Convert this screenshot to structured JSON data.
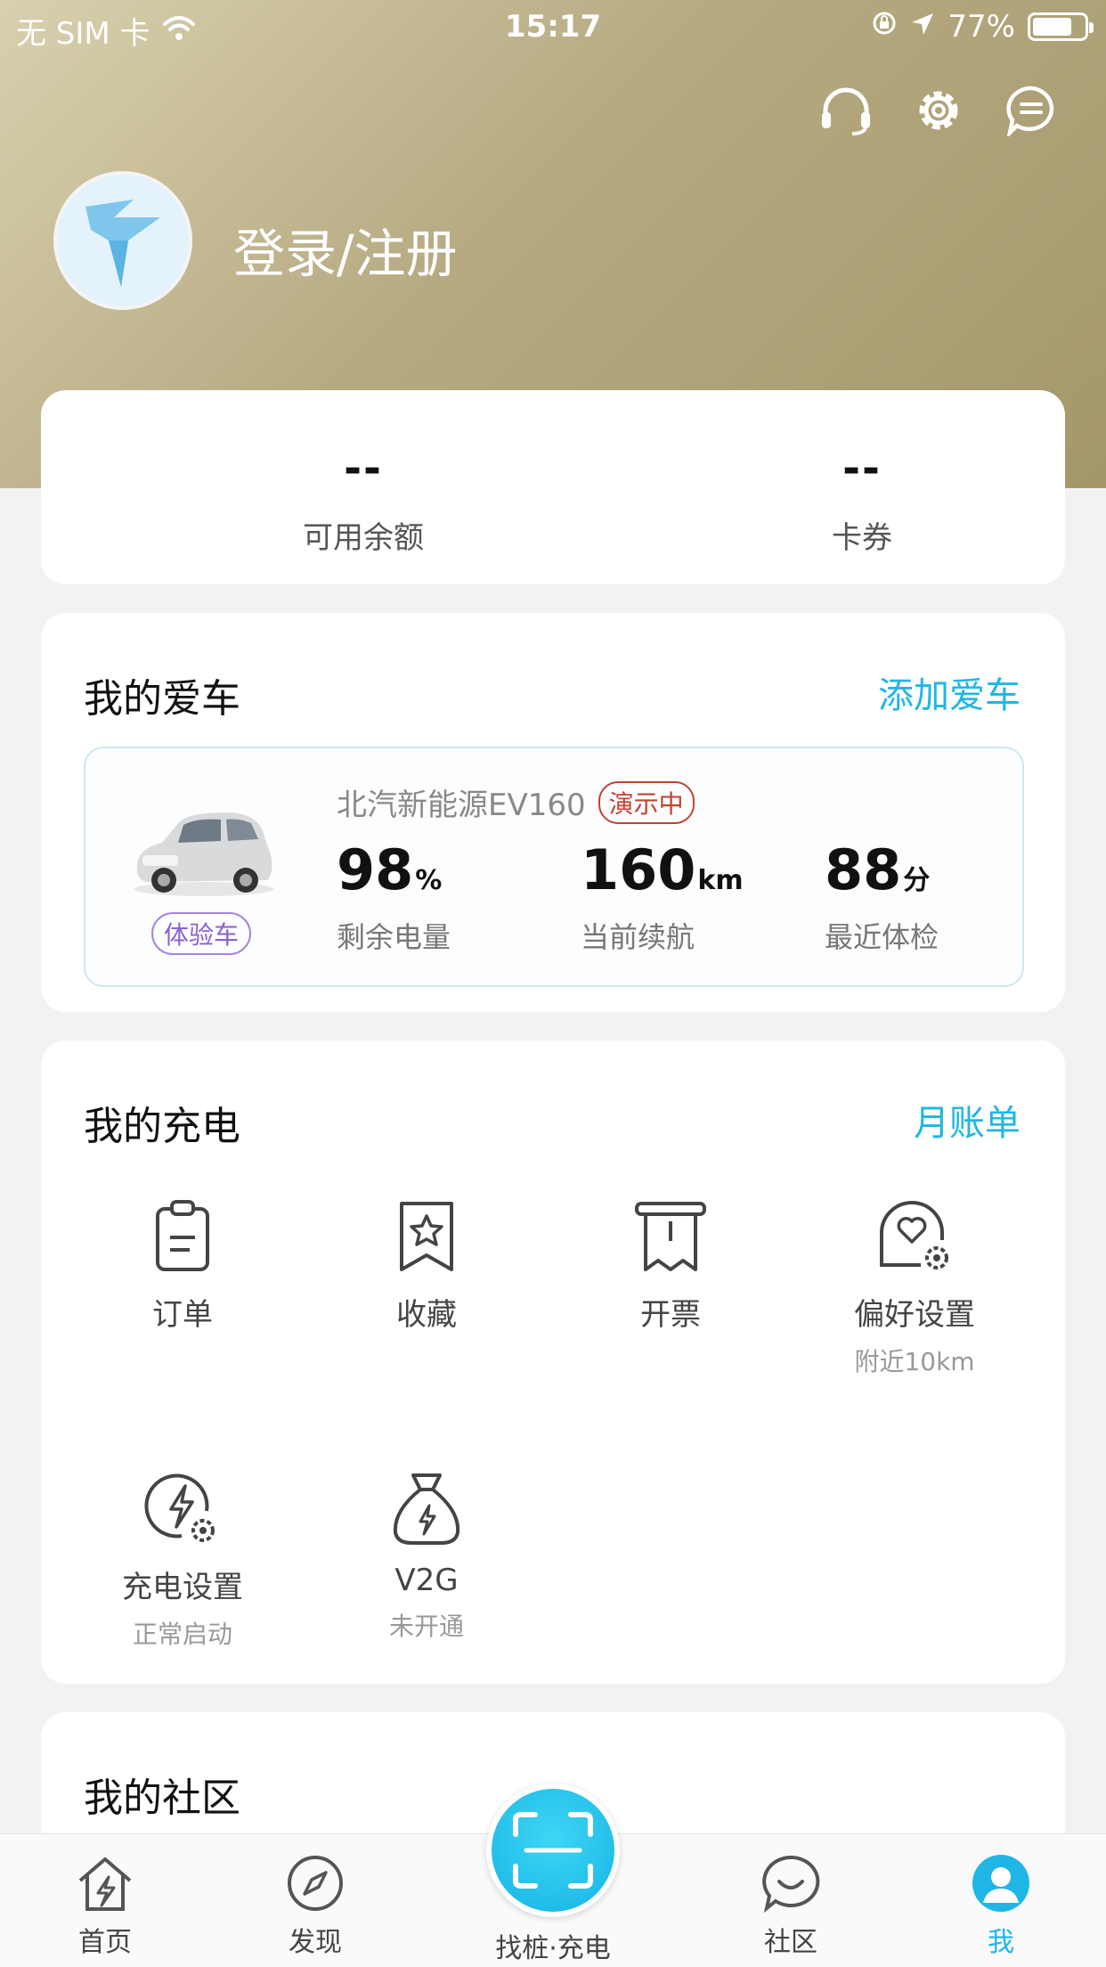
{
  "status_bar": {
    "carrier": "无 SIM 卡",
    "time": "15:17",
    "battery_percent": "77%",
    "battery_level": 0.77
  },
  "header": {
    "icons": [
      "headset-icon",
      "gear-icon",
      "message-icon"
    ],
    "login_text": "登录/注册"
  },
  "balance": {
    "available_value": "--",
    "available_label": "可用余额",
    "coupon_value": "--",
    "coupon_label": "卡券"
  },
  "my_car": {
    "title": "我的爱车",
    "add_link": "添加爱车",
    "car_name": "北汽新能源EV160",
    "demo_badge": "演示中",
    "trial_tag": "体验车",
    "stats": [
      {
        "value": "98",
        "unit": "%",
        "label": "剩余电量"
      },
      {
        "value": "160",
        "unit": "km",
        "label": "当前续航"
      },
      {
        "value": "88",
        "unit": "分",
        "label": "最近体检"
      }
    ]
  },
  "my_charge": {
    "title": "我的充电",
    "bill_link": "月账单",
    "items": [
      {
        "label": "订单",
        "sub": "",
        "icon": "clipboard-icon"
      },
      {
        "label": "收藏",
        "sub": "",
        "icon": "star-bookmark-icon"
      },
      {
        "label": "开票",
        "sub": "",
        "icon": "receipt-icon"
      },
      {
        "label": "偏好设置",
        "sub": "附近10km",
        "icon": "heart-settings-icon"
      },
      {
        "label": "充电设置",
        "sub": "正常启动",
        "icon": "bolt-settings-icon"
      },
      {
        "label": "V2G",
        "sub": "未开通",
        "icon": "money-bag-icon"
      }
    ]
  },
  "community": {
    "title": "我的社区"
  },
  "tab_bar": {
    "tabs": [
      {
        "label": "首页",
        "icon": "home-icon"
      },
      {
        "label": "发现",
        "icon": "compass-icon"
      },
      {
        "label": "找桩·充电",
        "icon": "scan-icon"
      },
      {
        "label": "社区",
        "icon": "chat-icon"
      },
      {
        "label": "我",
        "icon": "user-icon"
      }
    ],
    "active": "我"
  },
  "colors": {
    "accent": "#1fb6e6",
    "header_gold": "#b6aa82",
    "demo_red": "#c1432f",
    "trial_purple": "#8b5fd1"
  }
}
